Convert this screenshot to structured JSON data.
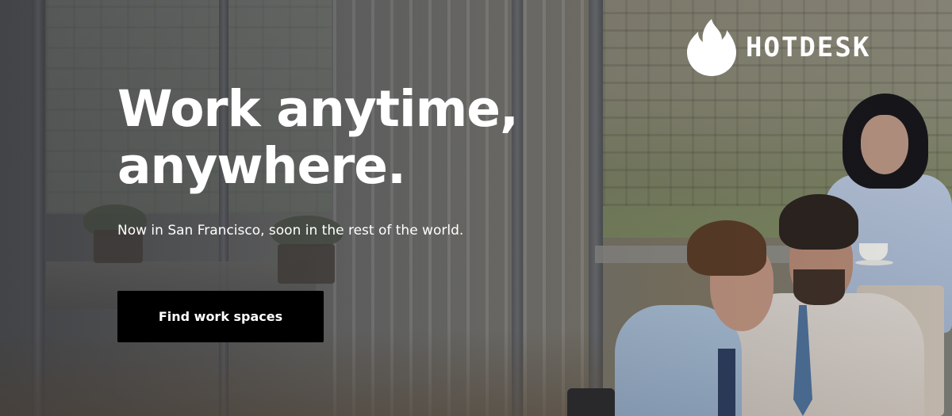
{
  "brand": {
    "name": "HOTDESK",
    "logo_icon": "flame-icon"
  },
  "hero": {
    "headline_line1": "Work anytime,",
    "headline_line2": "anywhere.",
    "subheadline": "Now in San Francisco, soon in the rest of the world.",
    "cta_label": "Find work spaces",
    "background_image": "office-team-photo"
  },
  "colors": {
    "text": "#ffffff",
    "button_bg": "#000000",
    "button_text": "#ffffff"
  }
}
